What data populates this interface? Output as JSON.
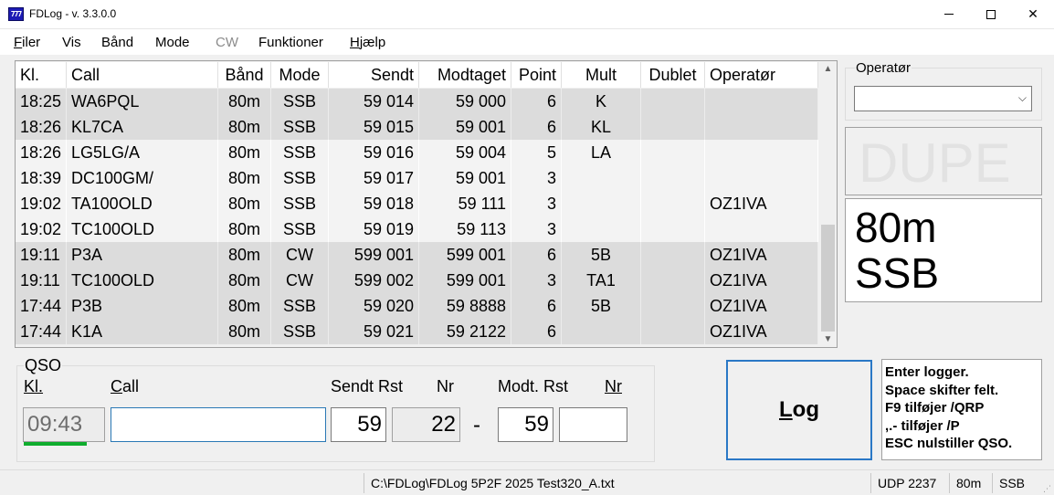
{
  "window": {
    "title": "FDLog - v. 3.3.0.0",
    "icon_text": "777",
    "minimize_icon": "minimize-icon",
    "maximize_icon": "maximize-icon",
    "close_icon": "close-icon"
  },
  "menu": [
    {
      "label": "Filer",
      "underline": "F",
      "rest": "iler",
      "enabled": true
    },
    {
      "label": "Vis",
      "underline": "",
      "rest": "Vis",
      "enabled": true
    },
    {
      "label": "Bånd",
      "underline": "",
      "rest": "Bånd",
      "enabled": true
    },
    {
      "label": "Mode",
      "underline": "",
      "rest": "Mode",
      "enabled": true
    },
    {
      "label": "CW",
      "underline": "",
      "rest": "CW",
      "enabled": false
    },
    {
      "label": "Funktioner",
      "underline": "",
      "rest": "Funktioner",
      "enabled": true
    },
    {
      "label": "Hjælp",
      "underline": "H",
      "rest": "jælp",
      "enabled": true
    }
  ],
  "log": {
    "columns": [
      "Kl.",
      "Call",
      "Bånd",
      "Mode",
      "Sendt",
      "Modtaget",
      "Point",
      "Mult",
      "Dublet",
      "Operatør"
    ],
    "rows": [
      {
        "kl": "18:25",
        "call": "WA6PQL",
        "band": "80m",
        "mode": "SSB",
        "sendt": "59 014",
        "modt": "59 000",
        "point": "6",
        "mult": "K",
        "dub": "",
        "op": "",
        "shade": "dark"
      },
      {
        "kl": "18:26",
        "call": "KL7CA",
        "band": "80m",
        "mode": "SSB",
        "sendt": "59 015",
        "modt": "59 001",
        "point": "6",
        "mult": "KL",
        "dub": "",
        "op": "",
        "shade": "dark"
      },
      {
        "kl": "18:26",
        "call": "LG5LG/A",
        "band": "80m",
        "mode": "SSB",
        "sendt": "59 016",
        "modt": "59 004",
        "point": "5",
        "mult": "LA",
        "dub": "",
        "op": "",
        "shade": "light"
      },
      {
        "kl": "18:39",
        "call": "DC100GM/",
        "band": "80m",
        "mode": "SSB",
        "sendt": "59 017",
        "modt": "59 001",
        "point": "3",
        "mult": "",
        "dub": "",
        "op": "",
        "shade": "light"
      },
      {
        "kl": "19:02",
        "call": "TA100OLD",
        "band": "80m",
        "mode": "SSB",
        "sendt": "59 018",
        "modt": "59 111",
        "point": "3",
        "mult": "",
        "dub": "",
        "op": "OZ1IVA",
        "shade": "light"
      },
      {
        "kl": "19:02",
        "call": "TC100OLD",
        "band": "80m",
        "mode": "SSB",
        "sendt": "59 019",
        "modt": "59 113",
        "point": "3",
        "mult": "",
        "dub": "",
        "op": "",
        "shade": "light"
      },
      {
        "kl": "19:11",
        "call": "P3A",
        "band": "80m",
        "mode": "CW",
        "sendt": "599 001",
        "modt": "599 001",
        "point": "6",
        "mult": "5B",
        "dub": "",
        "op": "OZ1IVA",
        "shade": "dark"
      },
      {
        "kl": "19:11",
        "call": "TC100OLD",
        "band": "80m",
        "mode": "CW",
        "sendt": "599 002",
        "modt": "599 001",
        "point": "3",
        "mult": "TA1",
        "dub": "",
        "op": "OZ1IVA",
        "shade": "dark"
      },
      {
        "kl": "17:44",
        "call": "P3B",
        "band": "80m",
        "mode": "SSB",
        "sendt": "59 020",
        "modt": "59 8888",
        "point": "6",
        "mult": "5B",
        "dub": "",
        "op": "OZ1IVA",
        "shade": "dark"
      },
      {
        "kl": "17:44",
        "call": "K1A",
        "band": "80m",
        "mode": "SSB",
        "sendt": "59 021",
        "modt": "59 2122",
        "point": "6",
        "mult": "",
        "dub": "",
        "op": "OZ1IVA",
        "shade": "dark"
      }
    ],
    "scroll": {
      "thumb_start_fraction": 0.58,
      "thumb_size_fraction": 0.42
    }
  },
  "operator": {
    "label": "Operatør",
    "selected": "",
    "dropdown_icon": "chevron-down-icon"
  },
  "dupe": {
    "text": "DUPE"
  },
  "current": {
    "band": "80m",
    "mode": "SSB"
  },
  "qso": {
    "title": "QSO",
    "labels": {
      "time": "Kl.",
      "call": "Call",
      "sent_rst": "Sendt Rst",
      "sent_nr": "Nr",
      "rcvd_rst": "Modt. Rst",
      "rcvd_nr": "Nr"
    },
    "time_value": "09:43",
    "call_value": "",
    "sent_rst_value": "59",
    "sent_nr_value": "22",
    "separator": "-",
    "rcvd_rst_value": "59",
    "rcvd_nr_value": ""
  },
  "log_button": {
    "label": "Log",
    "underline": "L",
    "rest": "og"
  },
  "help": {
    "lines": [
      "Enter logger.",
      "Space skifter felt.",
      "F9 tilføjer /QRP",
      ",.- tilføjer /P",
      "ESC nulstiller QSO."
    ]
  },
  "status": {
    "file": "C:\\FDLog\\FDLog 5P2F 2025 Test320_A.txt",
    "udp": "UDP 2237",
    "band": "80m",
    "mode": "SSB"
  },
  "colors": {
    "accent": "#2a78c6",
    "time_bar": "#0fad2d",
    "row_dark": "#dcdcdc",
    "row_light": "#f3f3f3"
  }
}
